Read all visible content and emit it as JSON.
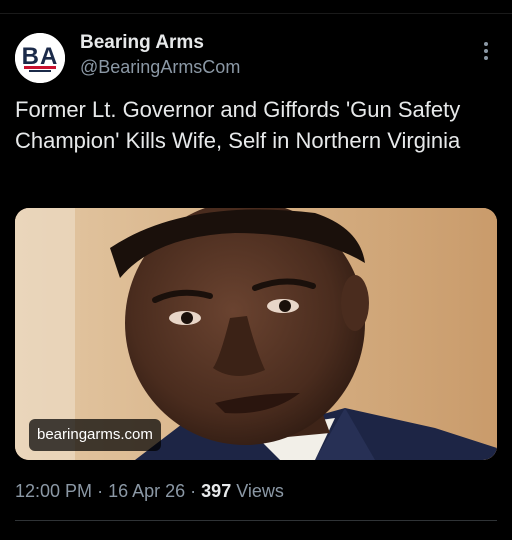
{
  "author": {
    "display_name": "Bearing Arms",
    "handle": "@BearingArmsCom",
    "avatar_logo_text": "BA"
  },
  "tweet": {
    "text": "Former Lt. Governor and Giffords 'Gun Safety Champion' Kills Wife, Self in Northern Virginia",
    "link_card": {
      "domain": "bearingarms.com"
    },
    "time": "12:00 PM",
    "date": "16 Apr 26",
    "separator": "·",
    "views_count": "397",
    "views_label": "Views"
  },
  "icons": {
    "more": "more-vertical-icon"
  },
  "colors": {
    "background": "#000000",
    "primary_text": "#e7e9ea",
    "secondary_text": "#8b98a5",
    "avatar_red": "#c8102e",
    "avatar_dark": "#1b2a49"
  }
}
